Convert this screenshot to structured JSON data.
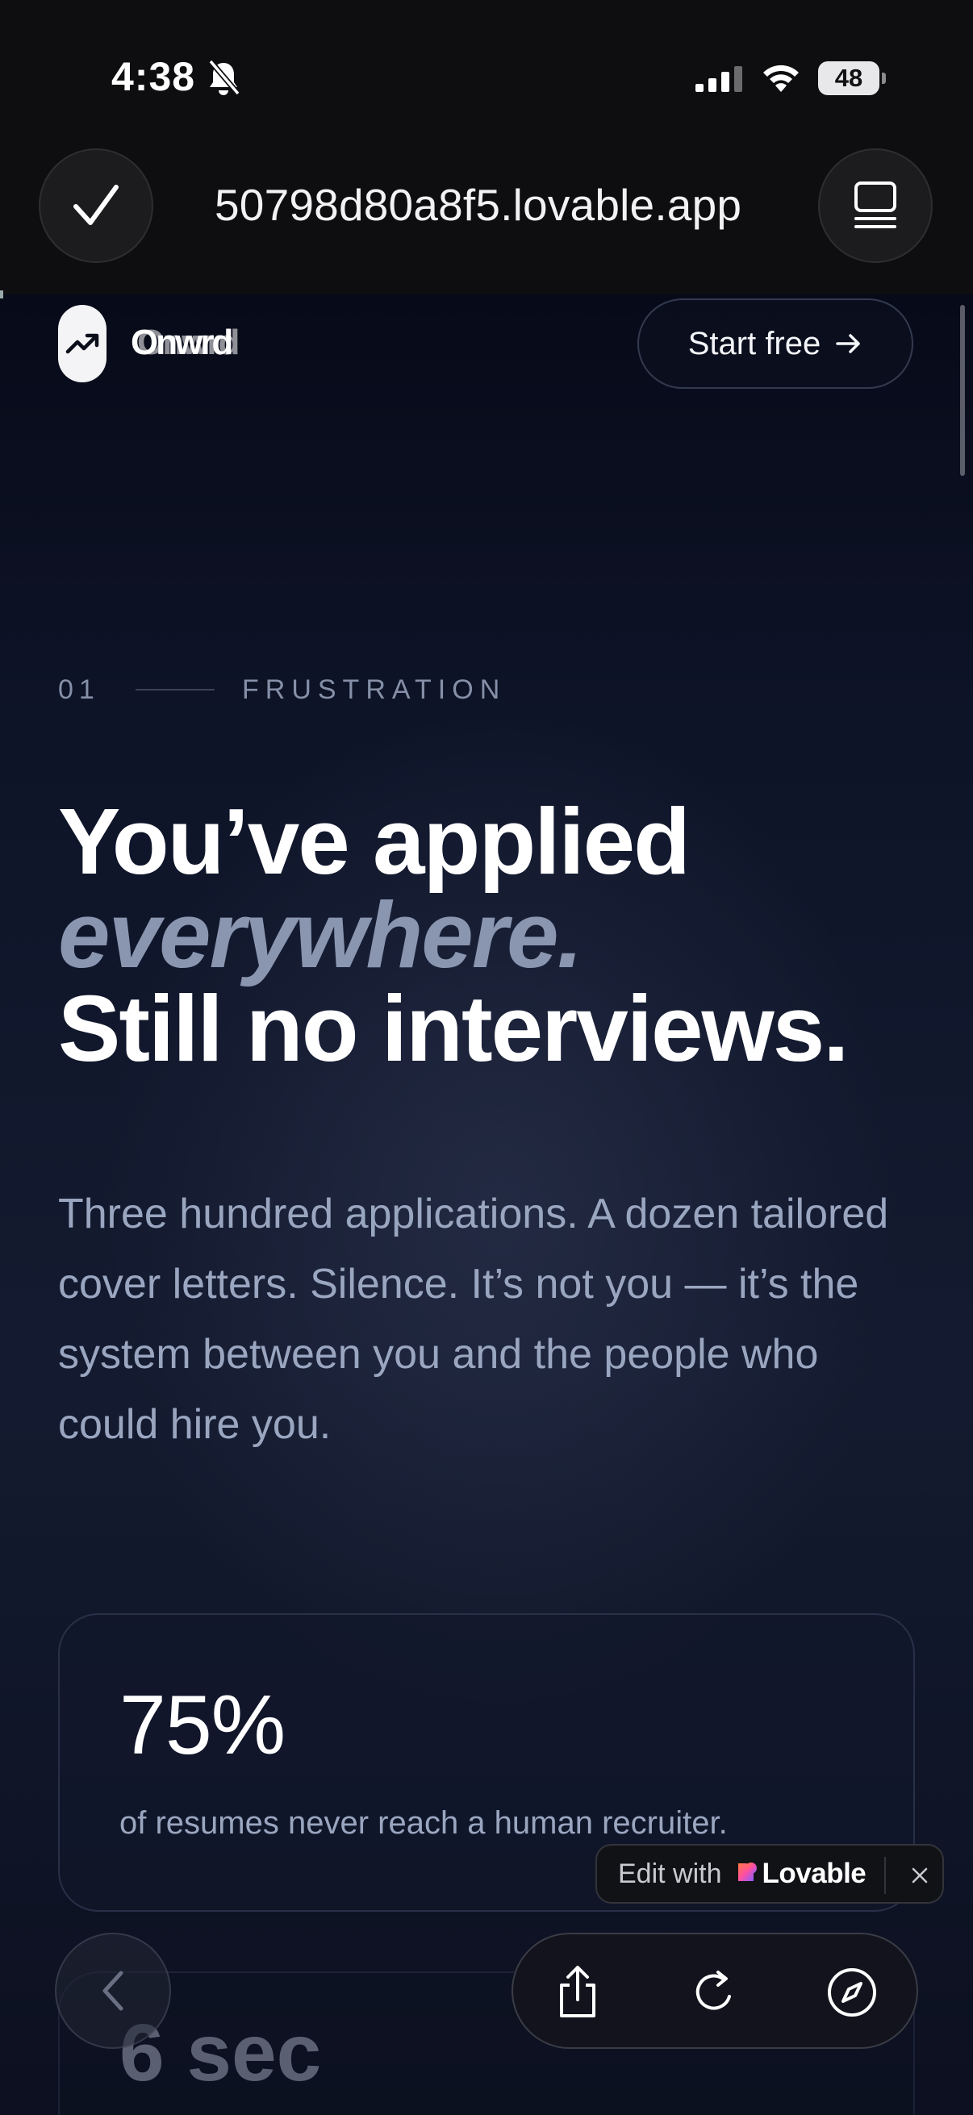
{
  "status_bar": {
    "time": "4:38",
    "battery_level": "48"
  },
  "browser": {
    "url": "50798d80a8f5.lovable.app"
  },
  "site_header": {
    "logo_text": "Onwrd",
    "logo_ghost_text": "Onwrd",
    "cta_label": "Start free"
  },
  "section": {
    "number": "01",
    "title": "FRUSTRATION"
  },
  "headline": {
    "line1": "You’ve applied",
    "line2": "everywhere.",
    "line3": "Still no interviews."
  },
  "body": "Three hundred applications. A dozen tailored cover letters. Silence. It’s not you — it’s the system between you and the people who could hire you.",
  "stats": [
    {
      "value": "75%",
      "description": "of resumes never reach a human recruiter."
    },
    {
      "value": "6 sec"
    }
  ],
  "lovable_badge": {
    "prefix": "Edit with",
    "brand": "Lovable"
  },
  "colors": {
    "accent_text": "#8a96b0",
    "body_text": "#9aa6c0",
    "background": "#0b0e1a",
    "lovable_gradient": [
      "#ff4fa3",
      "#ff7a3c",
      "#8a5cff"
    ]
  },
  "icons": {
    "status": [
      "bell-slash-icon",
      "signal-icon",
      "wifi-icon",
      "battery-icon"
    ],
    "browser_top": [
      "checkmark-icon",
      "tabs-icon"
    ],
    "header": [
      "trending-up-icon",
      "arrow-right-icon"
    ],
    "browser_bottom": [
      "chevron-left-icon",
      "share-icon",
      "reload-icon",
      "compass-icon"
    ],
    "badge": [
      "heart-icon",
      "close-icon"
    ]
  }
}
